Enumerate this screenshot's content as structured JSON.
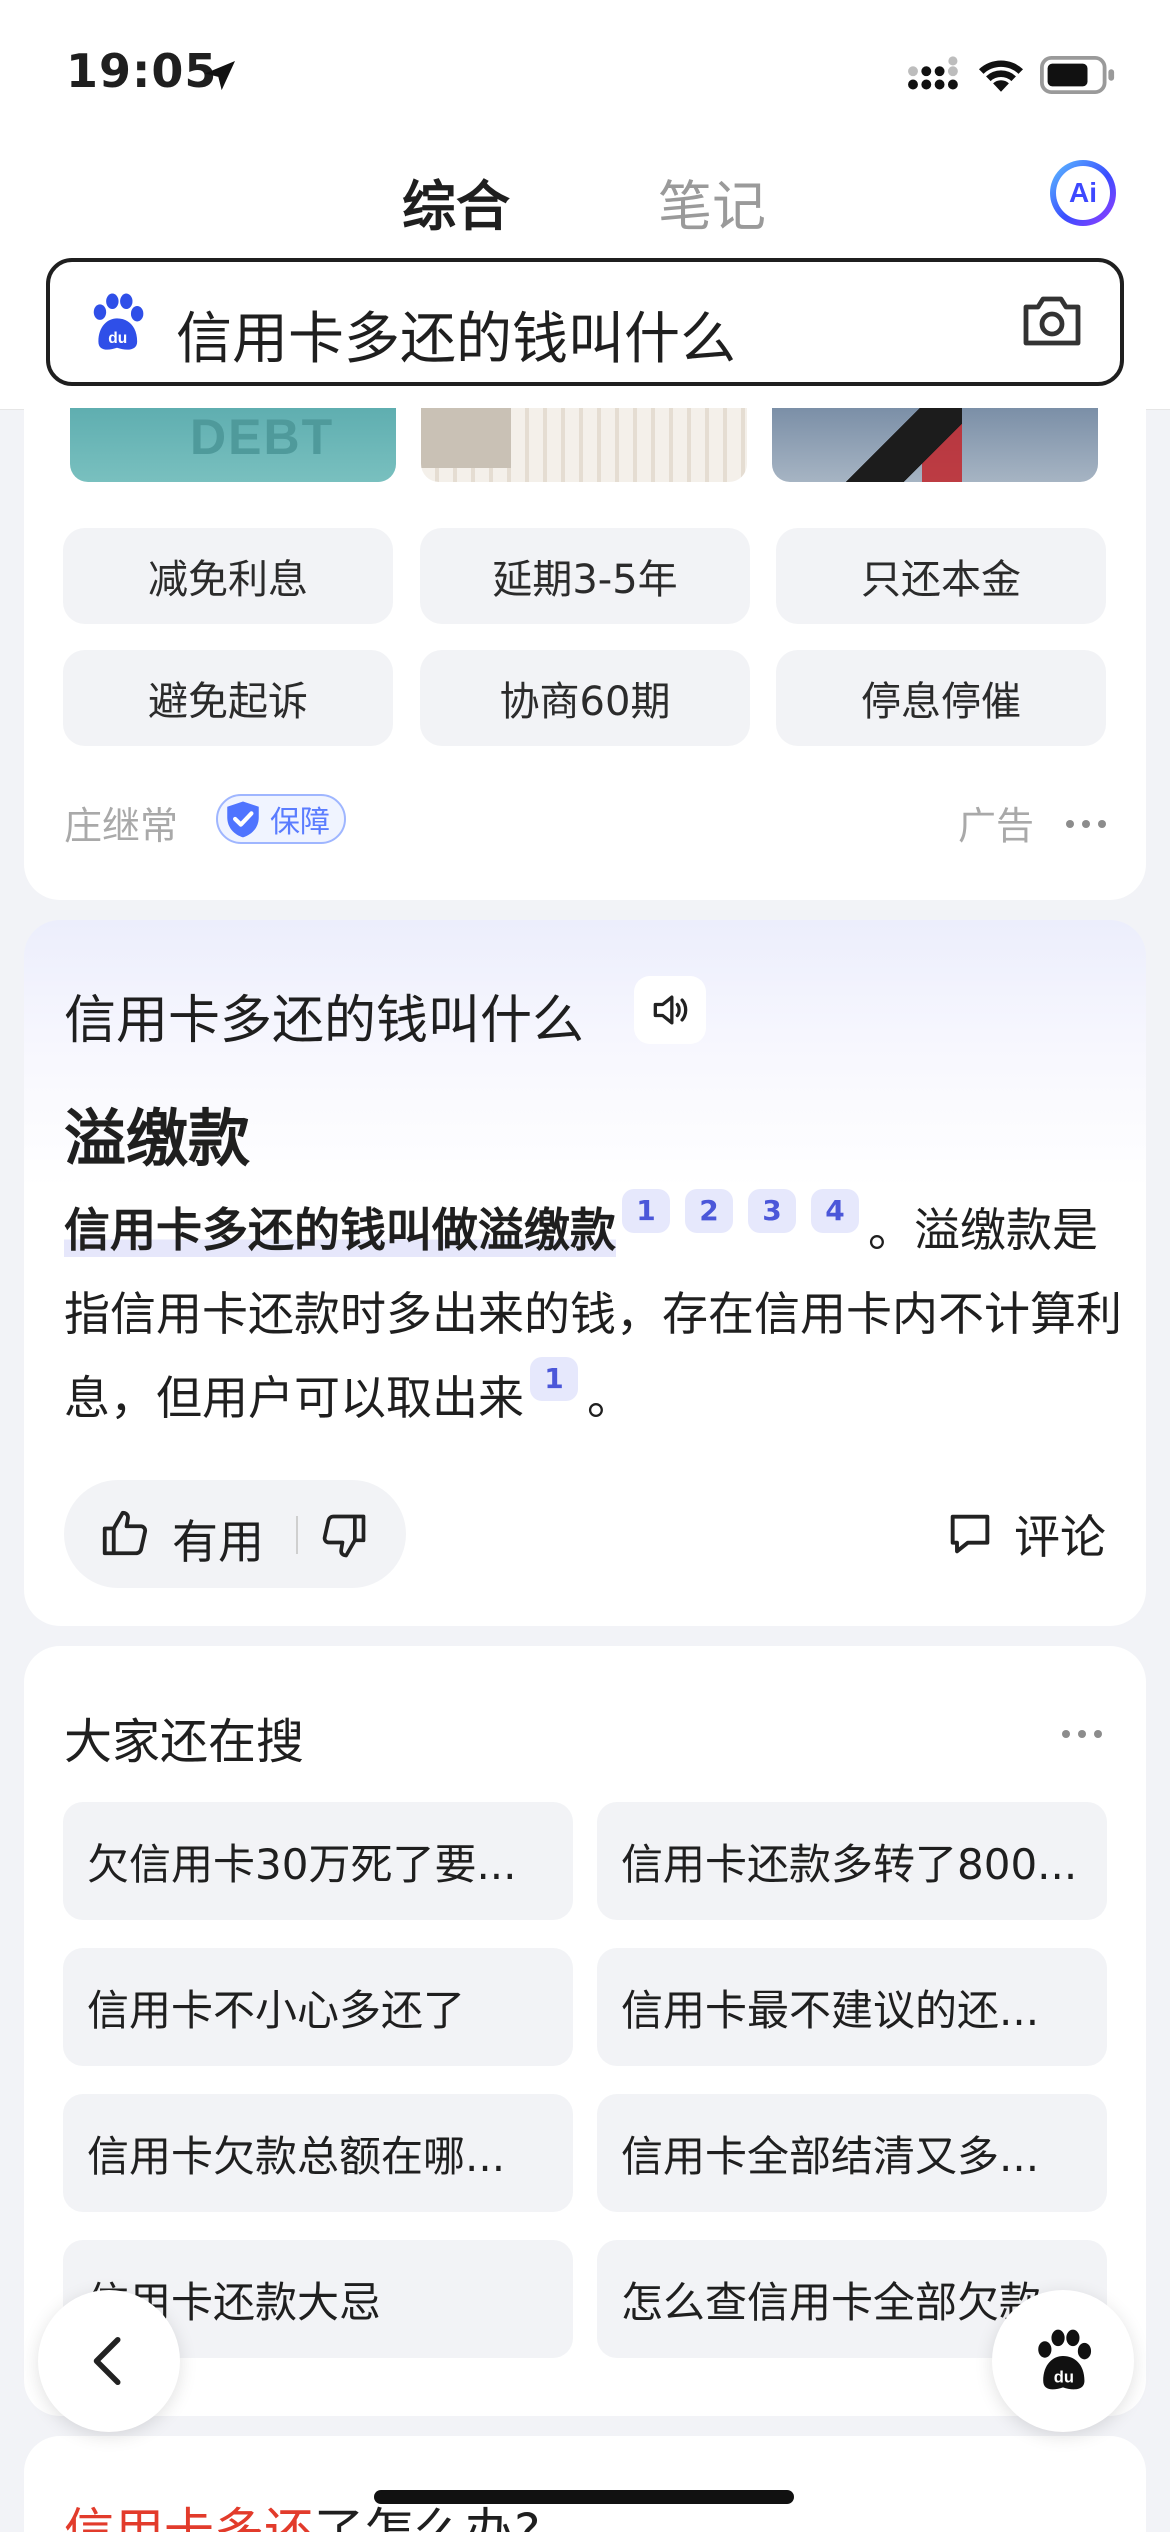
{
  "status_bar": {
    "time": "19:05"
  },
  "header": {
    "tabs": [
      {
        "label": "综合",
        "active": true
      },
      {
        "label": "笔记",
        "active": false
      }
    ],
    "ai_label": "Ai"
  },
  "search": {
    "query": "信用卡多还的钱叫什么"
  },
  "ad": {
    "image_text": "DEBT",
    "chips": [
      "减免利息",
      "延期3-5年",
      "只还本金",
      "避免起诉",
      "协商60期",
      "停息停催"
    ],
    "advertiser": "庄继常",
    "badge": "保障",
    "ad_label": "广告"
  },
  "answer": {
    "question": "信用卡多还的钱叫什么",
    "title": "溢缴款",
    "lead": "信用卡多还的钱叫做溢缴款",
    "lead_citations": [
      "1",
      "2",
      "3",
      "4"
    ],
    "body_part1": "。溢缴款是指信用卡还款时多出来的钱，存在信用卡内不计算利息，但用户可以取出来",
    "body_citation": "1",
    "body_part2": "。",
    "useful_label": "有用",
    "comment_label": "评论"
  },
  "related": {
    "title": "大家还在搜",
    "items": [
      "欠信用卡30万死了要...",
      "信用卡还款多转了800...",
      "信用卡不小心多还了",
      "信用卡最不建议的还...",
      "信用卡欠款总额在哪...",
      "信用卡全部结清又多...",
      "信用卡还款大忌",
      "怎么查信用卡全部欠款"
    ]
  },
  "next_card": {
    "title_highlight": "信用卡多还",
    "title_rest": "了怎么办?"
  },
  "colors": {
    "accent": "#4b57d9",
    "highlight_red": "#e23b2b",
    "background": "#f2f3f7"
  }
}
